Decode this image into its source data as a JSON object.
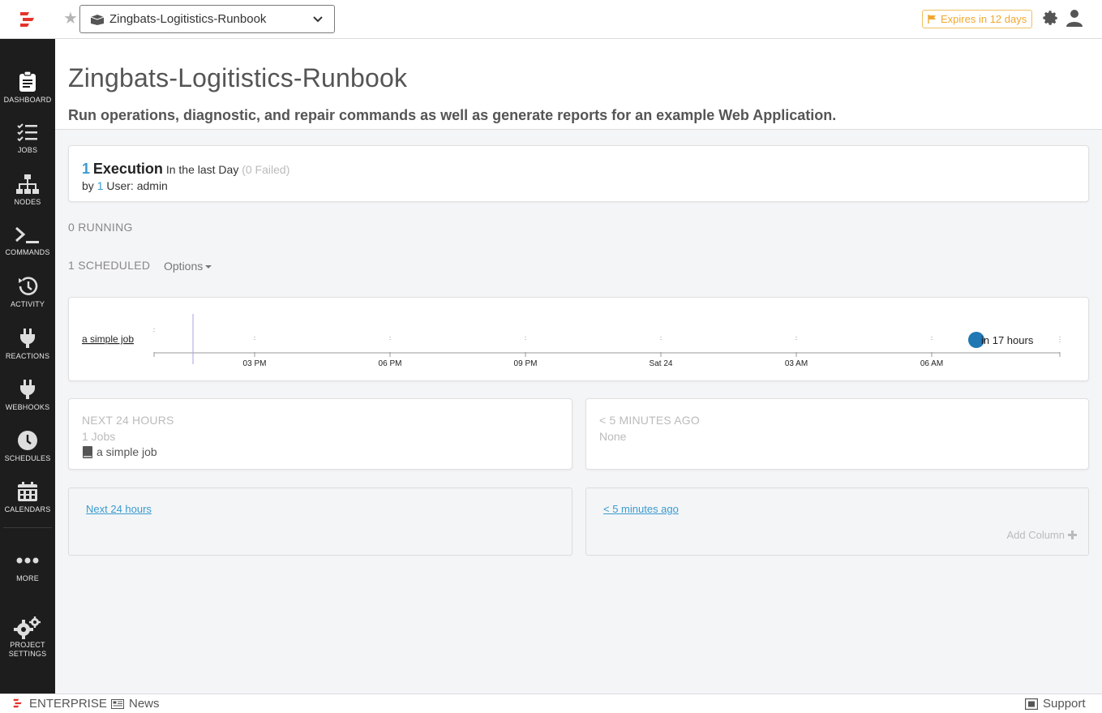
{
  "topbar": {
    "project_name": "Zingbats-Logitistics-Runbook",
    "expires_label": "Expires in 12 days",
    "accent_color": "#e4342a"
  },
  "sidebar": {
    "items": [
      {
        "label": "DASHBOARD",
        "icon": "clipboard-icon",
        "active": true
      },
      {
        "label": "JOBS",
        "icon": "job-list-icon"
      },
      {
        "label": "NODES",
        "icon": "sitemap-icon"
      },
      {
        "label": "COMMANDS",
        "icon": "terminal-icon"
      },
      {
        "label": "ACTIVITY",
        "icon": "history-icon"
      },
      {
        "label": "REACTIONS",
        "icon": "plug-icon"
      },
      {
        "label": "WEBHOOKS",
        "icon": "plug-icon"
      },
      {
        "label": "SCHEDULES",
        "icon": "clock-icon"
      },
      {
        "label": "CALENDARS",
        "icon": "calendar-icon"
      },
      {
        "label": "MORE",
        "icon": "ellipsis-icon"
      },
      {
        "label_line1": "PROJECT",
        "label_line2": "SETTINGS",
        "icon": "gears-icon"
      }
    ]
  },
  "header": {
    "title": "Zingbats-Logitistics-Runbook",
    "description": "Run operations, diagnostic, and repair commands as well as generate reports for an example Web Application."
  },
  "executions": {
    "count": "1",
    "label": "Execution",
    "period": "In the last Day",
    "failed": "(0 Failed)",
    "by_prefix": "by",
    "user_count": "1",
    "user_label": "User: admin"
  },
  "running": "0 RUNNING",
  "scheduled": {
    "label": "1 SCHEDULED",
    "options_label": "Options"
  },
  "timeline": {
    "row_label": "a simple job",
    "ticks": [
      "03 PM",
      "06 PM",
      "09 PM",
      "Sat 24",
      "03 AM",
      "06 AM"
    ],
    "event_label": "in 17 hours",
    "event_color": "#1f77b4"
  },
  "next_summary": {
    "title": "NEXT 24 HOURS",
    "sub": "1 Jobs",
    "item": "a simple job"
  },
  "ago_summary": {
    "title": "< 5 MINUTES AGO",
    "sub": "None"
  },
  "columns": {
    "next_link": "Next 24 hours",
    "ago_link": "< 5 minutes ago",
    "add_column": "Add Column"
  },
  "footer": {
    "edition": "ENTERPRISE",
    "news": "News",
    "support": "Support"
  }
}
